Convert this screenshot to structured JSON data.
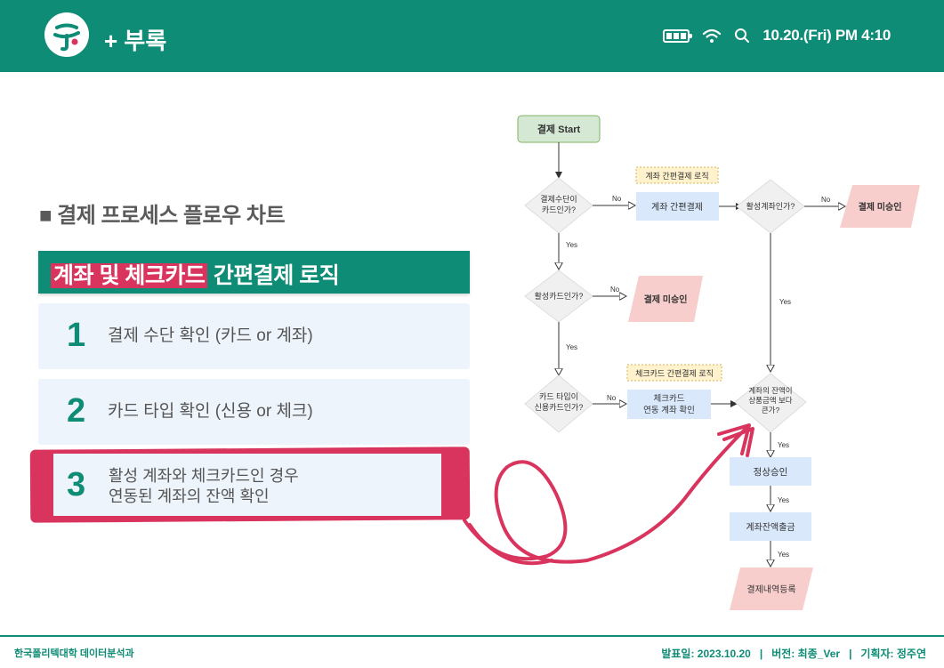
{
  "header": {
    "title": "+ 부록",
    "time": "10.20.(Fri) PM 4:10",
    "icons": [
      "battery-icon",
      "wifi-icon",
      "search-icon"
    ]
  },
  "main": {
    "section_title": "■ 결제 프로세스 플로우 차트",
    "banner": {
      "highlight": "계좌 및 체크카드",
      "rest": " 간편결제 로직"
    },
    "steps": [
      {
        "num": "1",
        "text": "결제 수단 확인 (카드 or 계좌)"
      },
      {
        "num": "2",
        "text": "카드 타입 확인 (신용 or 체크)"
      },
      {
        "num": "3",
        "line1": "활성 계좌와 체크카드인 경우",
        "line2": "연동된 계좌의 잔액 확인"
      }
    ]
  },
  "flowchart": {
    "start": "결제 Start",
    "tag_account": "계좌 간편결제 로직",
    "tag_check": "체크카드 간편결제 로직",
    "d_method": [
      "결제수단이",
      "카드인가?"
    ],
    "account_pay": "계좌 간편결제",
    "d_active_account": "활성계좌인가?",
    "deny1": "결제 미승인",
    "d_active_card": "활성카드인가?",
    "deny2": "결제 미승인",
    "d_card_type": [
      "카드 타입이",
      "신용카드인가?"
    ],
    "check_link": [
      "체크카드",
      "연동 계좌 확인"
    ],
    "d_balance": [
      "계좌의 잔액이",
      "상품금액 보다",
      "큰가?"
    ],
    "approve": "정상승인",
    "withdraw": "계좌잔액출금",
    "register": "결제내역등록",
    "yes": "Yes",
    "no": "No"
  },
  "footer": {
    "left": "한국폴리텍대학 데이터분석과",
    "right": "발표일: 2023.10.20   |   버전: 최종_Ver   |   기획자: 정주연"
  },
  "colors": {
    "brand": "#0e8c75",
    "accent": "#d9345d",
    "step_bg": "#eef4fc"
  }
}
